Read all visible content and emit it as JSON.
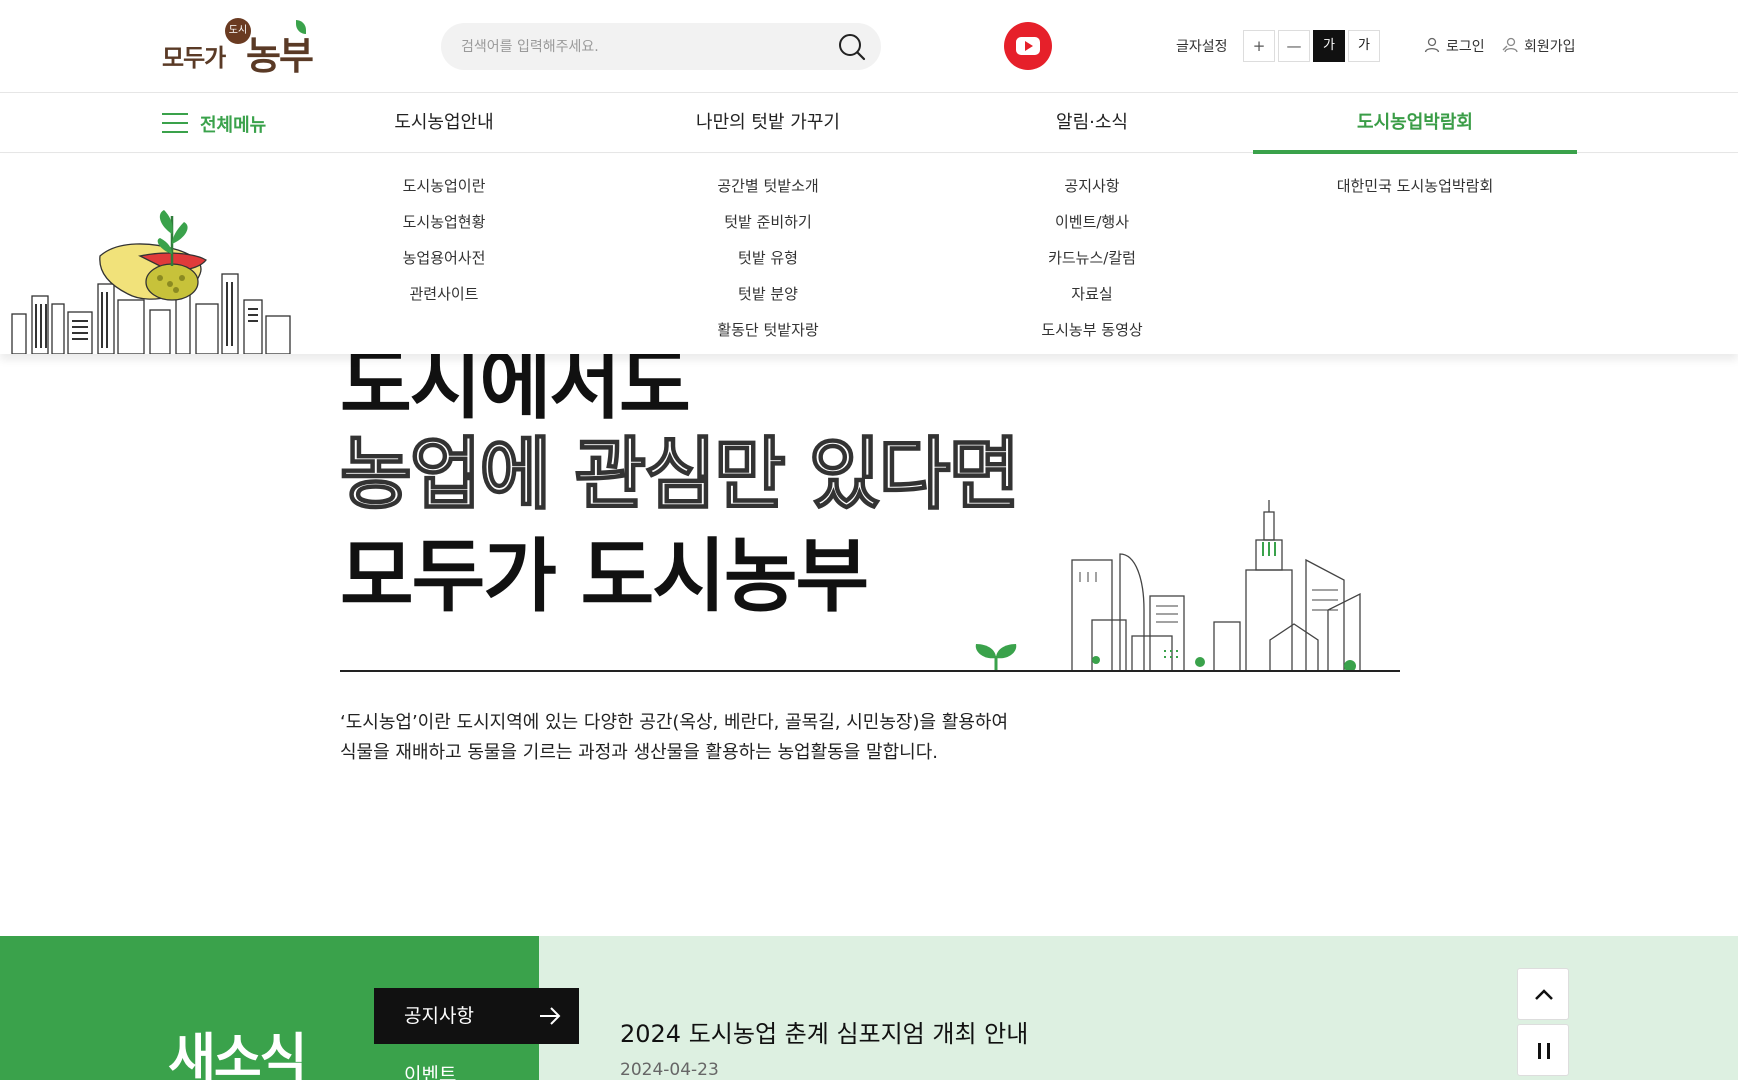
{
  "header": {
    "logo_small": "모두가",
    "logo_badge": "도시",
    "logo_big": "농부",
    "search_placeholder": "검색어를 입력해주세요.",
    "font_setting_label": "글자설정",
    "font_plus": "+",
    "font_minus": "—",
    "font_dark": "가",
    "font_light": "가",
    "login": "로그인",
    "join": "회원가입"
  },
  "gnb": {
    "all_menu": "전체메뉴",
    "items": [
      {
        "label": "도시농업안내"
      },
      {
        "label": "나만의 텃밭 가꾸기"
      },
      {
        "label": "알림·소식"
      },
      {
        "label": "도시농업박람회"
      }
    ]
  },
  "dropdown": {
    "col1": [
      "도시농업이란",
      "도시농업현황",
      "농업용어사전",
      "관련사이트"
    ],
    "col2": [
      "공간별 텃밭소개",
      "텃밭 준비하기",
      "텃밭 유형",
      "텃밭 분양",
      "활동단 텃밭자랑"
    ],
    "col3": [
      "공지사항",
      "이벤트/행사",
      "카드뉴스/칼럼",
      "자료실",
      "도시농부 동영상"
    ],
    "col4": [
      "대한민국 도시농업박람회"
    ]
  },
  "hero": {
    "line1": "도시에서도",
    "line2": "농업에 관심만 있다면",
    "line3": "모두가 도시농부",
    "desc1": "‘도시농업’이란 도시지역에 있는 다양한 공간(옥상, 베란다, 골목길, 시민농장)을 활용하여",
    "desc2": "식물을 재배하고 동물을 기르는 과정과 생산물을 활용하는 농업활동을 말합니다."
  },
  "news": {
    "title": "새소식",
    "tab_active": "공지사항",
    "tab_second": "이벤트",
    "item_title": "2024 도시농업 춘계 심포지엄 개최 안내",
    "item_date": "2024-04-23"
  },
  "colors": {
    "brand_green": "#3aa24b",
    "light_green": "#ddf0e1",
    "youtube_red": "#e6202a",
    "logo_brown": "#5a3a26"
  }
}
